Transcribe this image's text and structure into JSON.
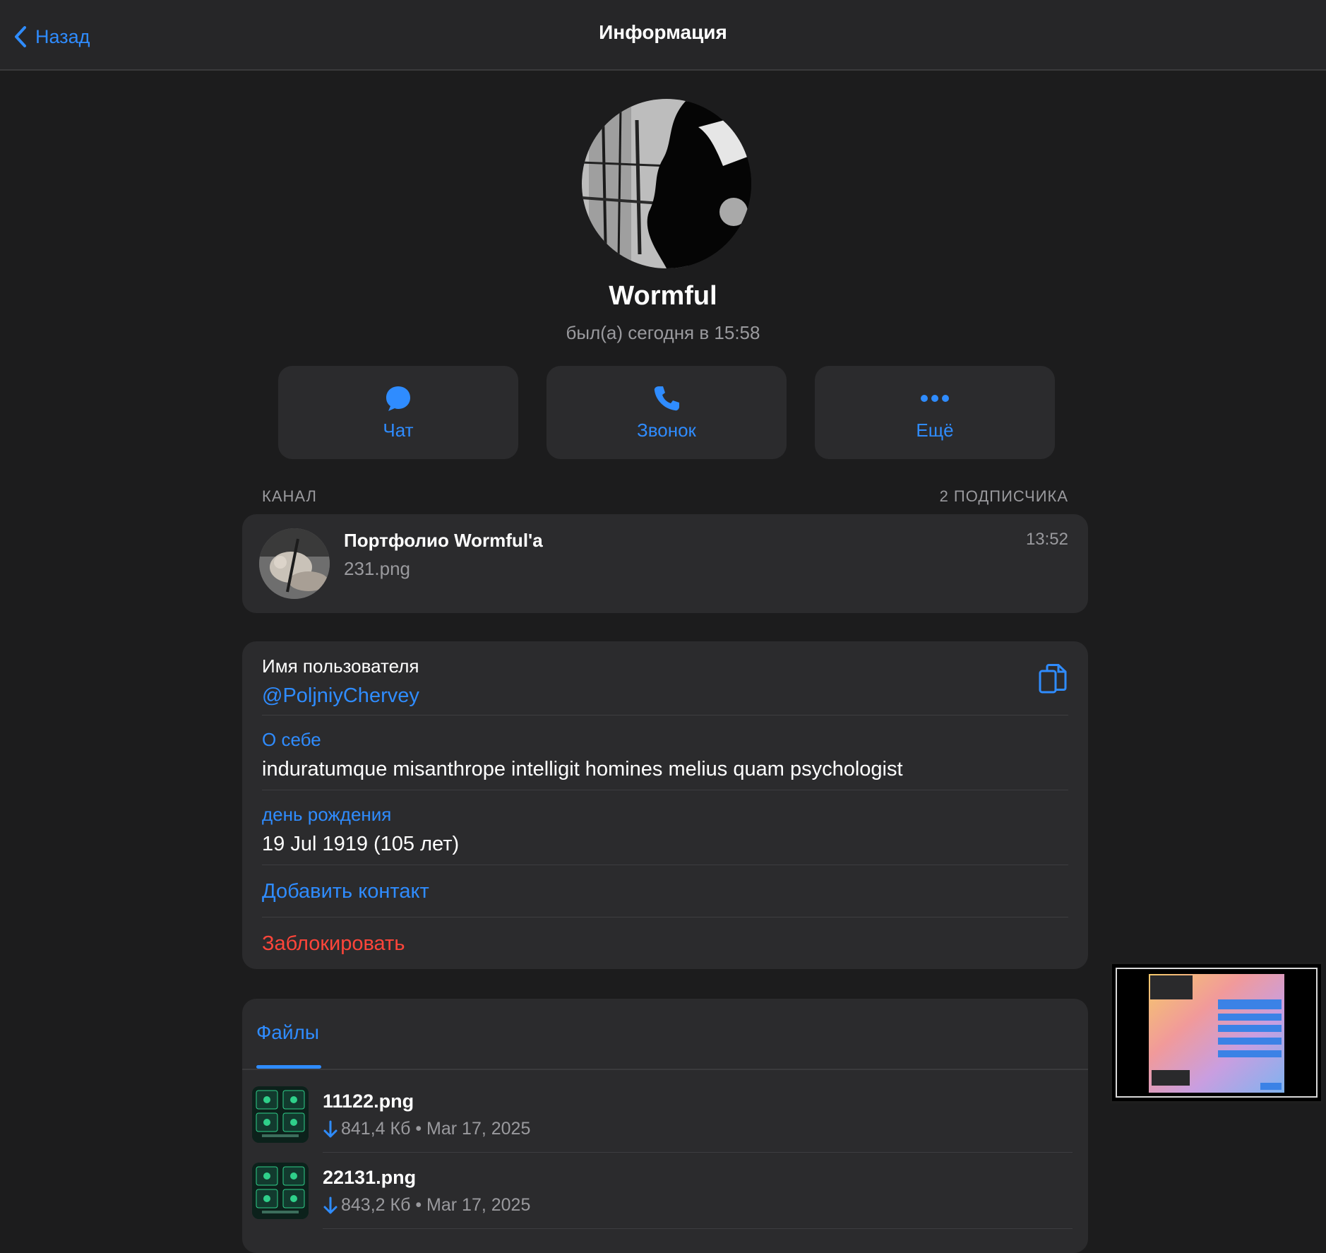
{
  "nav": {
    "back_label": "Назад",
    "title": "Информация"
  },
  "profile": {
    "name": "Wormful",
    "status": "был(а) сегодня в 15:58"
  },
  "actions": [
    {
      "label": "Чат",
      "icon": "chat-bubble-icon"
    },
    {
      "label": "Звонок",
      "icon": "phone-icon"
    },
    {
      "label": "Ещё",
      "icon": "more-dots-icon"
    }
  ],
  "channel": {
    "section_label": "КАНАЛ",
    "subscribers": "2 ПОДПИСЧИКА",
    "title": "Портфолио Wormful'а",
    "last_message": "231.png",
    "time": "13:52"
  },
  "info": {
    "username_label": "Имя пользователя",
    "username": "@PoljniyChervey",
    "about_label": "О себе",
    "about": "induratumque misanthrope intelligit homines melius quam psychologist",
    "birthday_label": "день рождения",
    "birthday": "19 Jul 1919 (105 лет)",
    "add_contact": "Добавить контакт",
    "block": "Заблокировать"
  },
  "media": {
    "tab_label": "Файлы",
    "files": [
      {
        "name": "11122.png",
        "size": "841,4 Кб",
        "date": "Mar 17, 2025"
      },
      {
        "name": "22131.png",
        "size": "843,2 Кб",
        "date": "Mar 17, 2025"
      }
    ]
  },
  "colors": {
    "accent": "#2f8cff",
    "danger": "#ff453a",
    "background": "#1c1c1d",
    "card": "#2b2b2d"
  }
}
